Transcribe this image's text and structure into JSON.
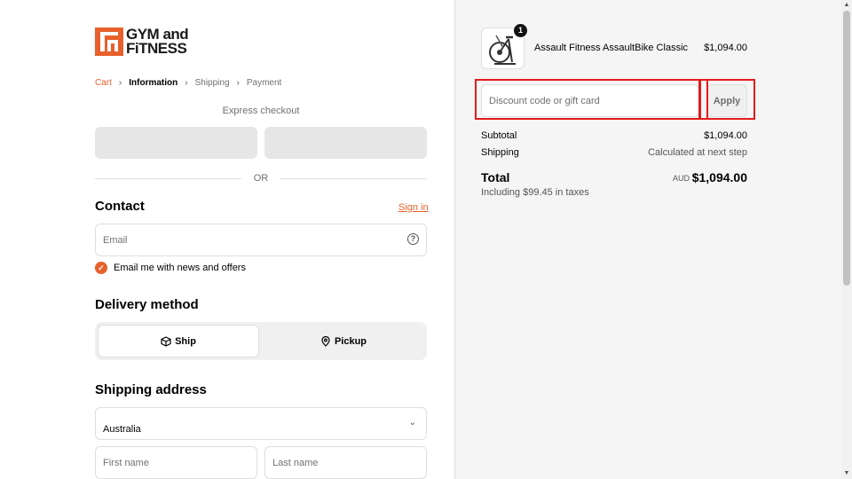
{
  "brand": {
    "logo_text_line1": "GYM and",
    "logo_text_line2": "FiTNESS",
    "accent_color": "#e8602c"
  },
  "breadcrumb": {
    "items": [
      "Cart",
      "Information",
      "Shipping",
      "Payment"
    ],
    "current": "Information"
  },
  "express": {
    "label": "Express checkout",
    "or": "OR"
  },
  "contact": {
    "heading": "Contact",
    "sign_in": "Sign in",
    "email_placeholder": "Email",
    "newsletter_label": "Email me with news and offers",
    "newsletter_checked": true
  },
  "delivery": {
    "heading": "Delivery method",
    "options": [
      {
        "label": "Ship",
        "icon": "box-icon",
        "selected": true
      },
      {
        "label": "Pickup",
        "icon": "location-pin-icon",
        "selected": false
      }
    ]
  },
  "shipping_address": {
    "heading": "Shipping address",
    "country_value": "Australia",
    "first_name_placeholder": "First name",
    "last_name_placeholder": "Last name"
  },
  "order": {
    "product": {
      "name": "Assault Fitness AssaultBike Classic",
      "price": "$1,094.00",
      "quantity": "1"
    },
    "discount_placeholder": "Discount code or gift card",
    "apply_label": "Apply",
    "subtotal_label": "Subtotal",
    "subtotal_value": "$1,094.00",
    "shipping_label": "Shipping",
    "shipping_value": "Calculated at next step",
    "total_label": "Total",
    "total_currency": "AUD",
    "total_value": "$1,094.00",
    "tax_note": "Including $99.45 in taxes"
  },
  "highlight_color": "#e21b1b"
}
